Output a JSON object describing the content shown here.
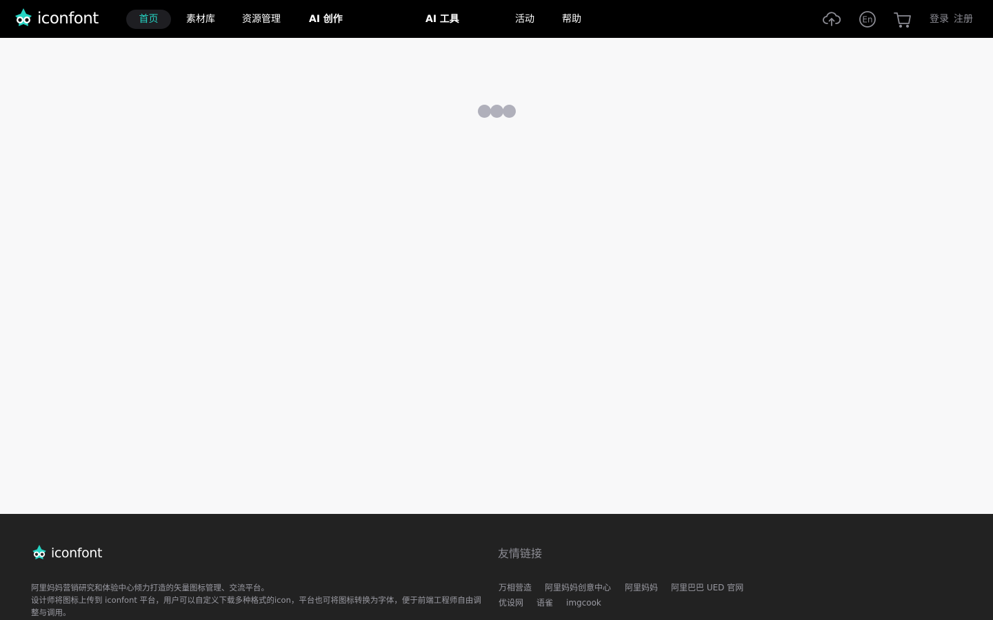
{
  "header": {
    "logo_text": "iconfont",
    "nav": [
      {
        "label": "首页"
      },
      {
        "label": "素材库"
      },
      {
        "label": "资源管理"
      },
      {
        "label": "AI 创作"
      },
      {
        "label": "AI 工具"
      },
      {
        "label": "活动"
      },
      {
        "label": "帮助"
      }
    ],
    "icons": {
      "upload": "cloud-upload-icon",
      "language": "language-en-icon",
      "cart": "cart-icon"
    },
    "language_label": "En",
    "login_label": "登录",
    "register_label": "注册",
    "accent_color": "#25d3c2"
  },
  "main": {
    "loading_indicator": "loading-dots-icon"
  },
  "footer": {
    "logo_text": "iconfont",
    "description": [
      "阿里妈妈营销研究和体验中心倾力打造的矢量图标管理、交流平台。",
      "设计师将图标上传到 iconfont 平台，用户可以自定义下载多种格式的icon，平台也可将图标转换为字体，便于前端工程师自由调整与调用。"
    ],
    "links_title": "友情链接",
    "links": [
      {
        "label": "万相营造"
      },
      {
        "label": "阿里妈妈创意中心"
      },
      {
        "label": "阿里妈妈"
      },
      {
        "label": "阿里巴巴 UED 官网"
      },
      {
        "label": "优设网"
      },
      {
        "label": "语雀"
      },
      {
        "label": "imgcook"
      }
    ]
  }
}
